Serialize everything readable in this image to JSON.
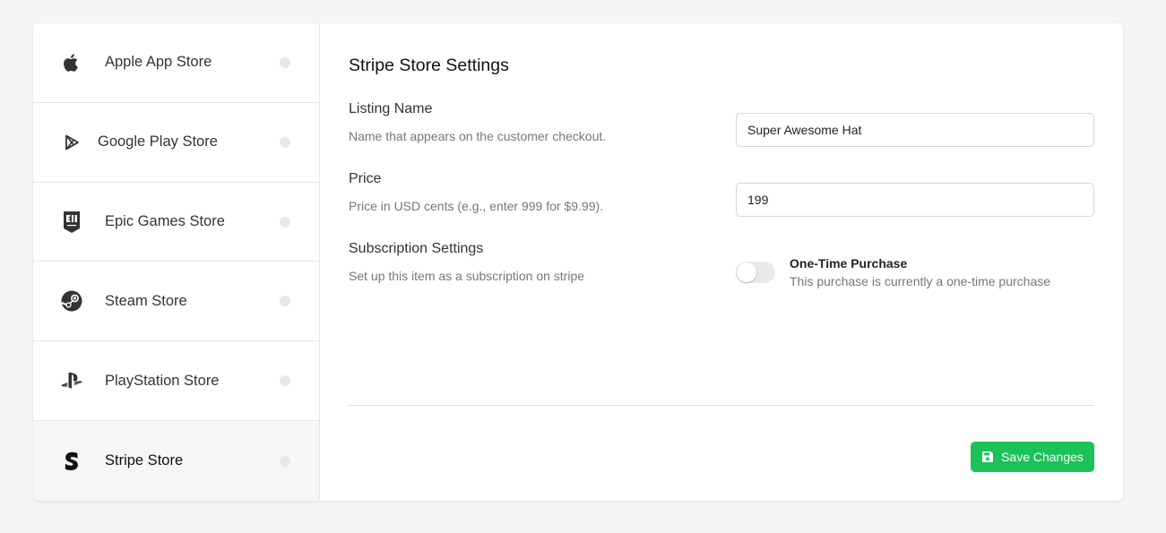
{
  "sidebar": {
    "items": [
      {
        "label": "Apple App Store",
        "icon": "apple-icon"
      },
      {
        "label": "Google Play Store",
        "icon": "google-play-icon"
      },
      {
        "label": "Epic Games Store",
        "icon": "epic-games-icon"
      },
      {
        "label": "Steam Store",
        "icon": "steam-icon"
      },
      {
        "label": "PlayStation Store",
        "icon": "playstation-icon"
      },
      {
        "label": "Stripe Store",
        "icon": "stripe-icon",
        "active": true
      }
    ]
  },
  "panel": {
    "title": "Stripe Store Settings",
    "listing": {
      "label": "Listing Name",
      "description": "Name that appears on the customer checkout.",
      "value": "Super Awesome Hat"
    },
    "price": {
      "label": "Price",
      "description": "Price in USD cents (e.g., enter 999 for $9.99).",
      "value": "199"
    },
    "subscription": {
      "label": "Subscription Settings",
      "description": "Set up this item as a subscription on stripe",
      "toggle_on": false,
      "toggle_title": "One-Time Purchase",
      "toggle_description": "This purchase is currently a one-time purchase"
    },
    "save_label": "Save Changes"
  },
  "colors": {
    "accent": "#1ac257",
    "background": "#f5f5f5",
    "status_dot": "#e8e8e8"
  }
}
